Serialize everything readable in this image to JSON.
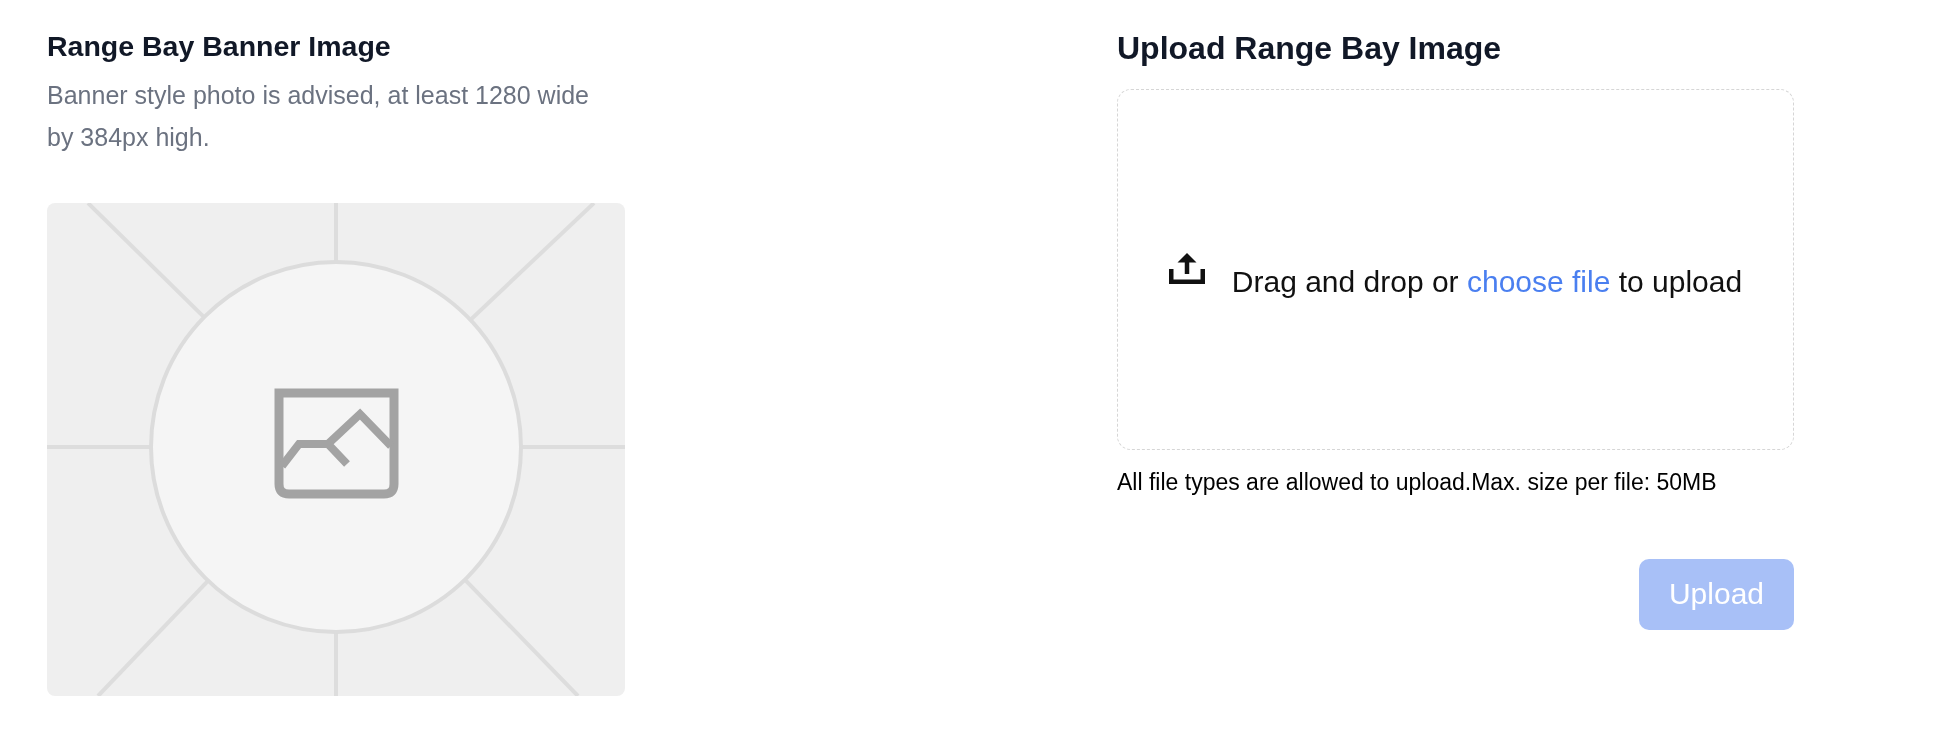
{
  "banner": {
    "title": "Range Bay Banner Image",
    "description": "Banner style photo is advised, at least 1280 wide by 384px high."
  },
  "upload": {
    "title": "Upload Range Bay Image",
    "dropzone": {
      "text_before": "Drag and drop or",
      "link": "choose file",
      "text_after": "to upload"
    },
    "note": "All file types are allowed to upload.Max. size per file: 50MB",
    "button": {
      "label": "Upload",
      "disabled": true
    }
  }
}
